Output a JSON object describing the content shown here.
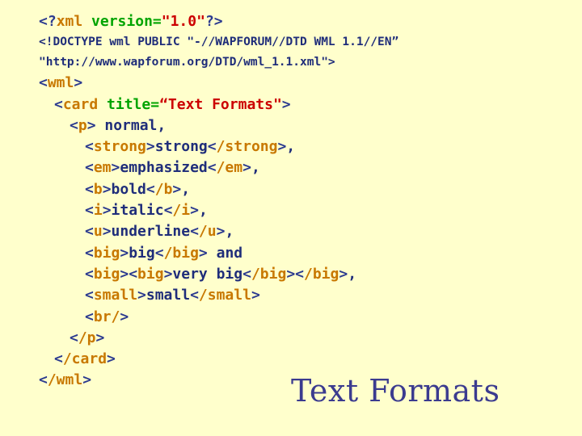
{
  "slide": {
    "background_color": "#FFFFCC",
    "title": "Text Formats"
  },
  "colors": {
    "background": "#FFFFCC",
    "punctuation": "#2B3A8F",
    "tag_name": "#C87800",
    "attribute_name": "#00A400",
    "attribute_value": "#CC0000",
    "plain_text": "#1F2D7A",
    "title": "#3B3B8F"
  },
  "code": {
    "language": "wml",
    "lines": [
      {
        "indent": "",
        "segments": [
          {
            "t": "<?",
            "c": "punct"
          },
          {
            "t": "xml",
            "c": "tag"
          },
          {
            "t": " ",
            "c": "text"
          },
          {
            "t": "version=",
            "c": "attr"
          },
          {
            "t": "\"1.0\"",
            "c": "value"
          },
          {
            "t": "?>",
            "c": "punct"
          }
        ],
        "plain": "<?xml version=\"1.0\"?>"
      },
      {
        "indent": "",
        "style": "doctype",
        "segments": [
          {
            "t": "<!DOCTYPE wml PUBLIC \"-//WAPFORUM//DTD WML 1.1//EN”",
            "c": "text"
          }
        ],
        "plain": "<!DOCTYPE wml PUBLIC \"-//WAPFORUM//DTD WML 1.1//EN”"
      },
      {
        "indent": "",
        "style": "doctype",
        "segments": [
          {
            "t": "\"http://www.wapforum.org/DTD/wml_1.1.xml\">",
            "c": "text"
          }
        ],
        "plain": "\"http://www.wapforum.org/DTD/wml_1.1.xml\">"
      },
      {
        "indent": "",
        "segments": [
          {
            "t": "<",
            "c": "punct"
          },
          {
            "t": "wml",
            "c": "tag"
          },
          {
            "t": ">",
            "c": "punct"
          }
        ],
        "plain": "<wml>"
      },
      {
        "indent": "  ",
        "segments": [
          {
            "t": "<",
            "c": "punct"
          },
          {
            "t": "card",
            "c": "tag"
          },
          {
            "t": " ",
            "c": "text"
          },
          {
            "t": "title=",
            "c": "attr"
          },
          {
            "t": "“Text Formats\"",
            "c": "value"
          },
          {
            "t": ">",
            "c": "punct"
          }
        ],
        "plain": "  <card title=“Text Formats\">"
      },
      {
        "indent": "    ",
        "segments": [
          {
            "t": "<",
            "c": "punct"
          },
          {
            "t": "p",
            "c": "tag"
          },
          {
            "t": ">",
            "c": "punct"
          },
          {
            "t": " normal,",
            "c": "text"
          }
        ],
        "plain": "    <p> normal,"
      },
      {
        "indent": "      ",
        "segments": [
          {
            "t": "<",
            "c": "punct"
          },
          {
            "t": "strong",
            "c": "tag"
          },
          {
            "t": ">",
            "c": "punct"
          },
          {
            "t": "strong",
            "c": "text"
          },
          {
            "t": "<",
            "c": "punct"
          },
          {
            "t": "/strong",
            "c": "tag"
          },
          {
            "t": ">",
            "c": "punct"
          },
          {
            "t": ",",
            "c": "text"
          }
        ],
        "plain": "      <strong>strong</strong>,"
      },
      {
        "indent": "      ",
        "segments": [
          {
            "t": "<",
            "c": "punct"
          },
          {
            "t": "em",
            "c": "tag"
          },
          {
            "t": ">",
            "c": "punct"
          },
          {
            "t": "emphasized",
            "c": "text"
          },
          {
            "t": "<",
            "c": "punct"
          },
          {
            "t": "/em",
            "c": "tag"
          },
          {
            "t": ">",
            "c": "punct"
          },
          {
            "t": ",",
            "c": "text"
          }
        ],
        "plain": "      <em>emphasized</em>,"
      },
      {
        "indent": "      ",
        "segments": [
          {
            "t": "<",
            "c": "punct"
          },
          {
            "t": "b",
            "c": "tag"
          },
          {
            "t": ">",
            "c": "punct"
          },
          {
            "t": "bold",
            "c": "text"
          },
          {
            "t": "<",
            "c": "punct"
          },
          {
            "t": "/b",
            "c": "tag"
          },
          {
            "t": ">",
            "c": "punct"
          },
          {
            "t": ",",
            "c": "text"
          }
        ],
        "plain": "      <b>bold</b>,"
      },
      {
        "indent": "      ",
        "segments": [
          {
            "t": "<",
            "c": "punct"
          },
          {
            "t": "i",
            "c": "tag"
          },
          {
            "t": ">",
            "c": "punct"
          },
          {
            "t": "italic",
            "c": "text"
          },
          {
            "t": "<",
            "c": "punct"
          },
          {
            "t": "/i",
            "c": "tag"
          },
          {
            "t": ">",
            "c": "punct"
          },
          {
            "t": ",",
            "c": "text"
          }
        ],
        "plain": "      <i>italic</i>,"
      },
      {
        "indent": "      ",
        "segments": [
          {
            "t": "<",
            "c": "punct"
          },
          {
            "t": "u",
            "c": "tag"
          },
          {
            "t": ">",
            "c": "punct"
          },
          {
            "t": "underline",
            "c": "text"
          },
          {
            "t": "<",
            "c": "punct"
          },
          {
            "t": "/u",
            "c": "tag"
          },
          {
            "t": ">",
            "c": "punct"
          },
          {
            "t": ",",
            "c": "text"
          }
        ],
        "plain": "      <u>underline</u>,"
      },
      {
        "indent": "      ",
        "segments": [
          {
            "t": "<",
            "c": "punct"
          },
          {
            "t": "big",
            "c": "tag"
          },
          {
            "t": ">",
            "c": "punct"
          },
          {
            "t": "big",
            "c": "text"
          },
          {
            "t": "<",
            "c": "punct"
          },
          {
            "t": "/big",
            "c": "tag"
          },
          {
            "t": ">",
            "c": "punct"
          },
          {
            "t": " and",
            "c": "text"
          }
        ],
        "plain": "      <big>big</big> and"
      },
      {
        "indent": "      ",
        "segments": [
          {
            "t": "<",
            "c": "punct"
          },
          {
            "t": "big",
            "c": "tag"
          },
          {
            "t": ">",
            "c": "punct"
          },
          {
            "t": "<",
            "c": "punct"
          },
          {
            "t": "big",
            "c": "tag"
          },
          {
            "t": ">",
            "c": "punct"
          },
          {
            "t": "very big",
            "c": "text"
          },
          {
            "t": "<",
            "c": "punct"
          },
          {
            "t": "/big",
            "c": "tag"
          },
          {
            "t": ">",
            "c": "punct"
          },
          {
            "t": "<",
            "c": "punct"
          },
          {
            "t": "/big",
            "c": "tag"
          },
          {
            "t": ">",
            "c": "punct"
          },
          {
            "t": ",",
            "c": "text"
          }
        ],
        "plain": "      <big><big>very big</big></big>,"
      },
      {
        "indent": "      ",
        "segments": [
          {
            "t": "<",
            "c": "punct"
          },
          {
            "t": "small",
            "c": "tag"
          },
          {
            "t": ">",
            "c": "punct"
          },
          {
            "t": "small",
            "c": "text"
          },
          {
            "t": "<",
            "c": "punct"
          },
          {
            "t": "/small",
            "c": "tag"
          },
          {
            "t": ">",
            "c": "punct"
          }
        ],
        "plain": "      <small>small</small>"
      },
      {
        "indent": "      ",
        "segments": [
          {
            "t": "<",
            "c": "punct"
          },
          {
            "t": "br/",
            "c": "tag"
          },
          {
            "t": ">",
            "c": "punct"
          }
        ],
        "plain": "      <br/>"
      },
      {
        "indent": "    ",
        "segments": [
          {
            "t": "<",
            "c": "punct"
          },
          {
            "t": "/p",
            "c": "tag"
          },
          {
            "t": ">",
            "c": "punct"
          }
        ],
        "plain": "    </p>"
      },
      {
        "indent": "  ",
        "segments": [
          {
            "t": "<",
            "c": "punct"
          },
          {
            "t": "/card",
            "c": "tag"
          },
          {
            "t": ">",
            "c": "punct"
          }
        ],
        "plain": "  </card>"
      },
      {
        "indent": "",
        "segments": [
          {
            "t": "<",
            "c": "punct"
          },
          {
            "t": "/wml",
            "c": "tag"
          },
          {
            "t": ">",
            "c": "punct"
          }
        ],
        "plain": "</wml>"
      }
    ]
  }
}
